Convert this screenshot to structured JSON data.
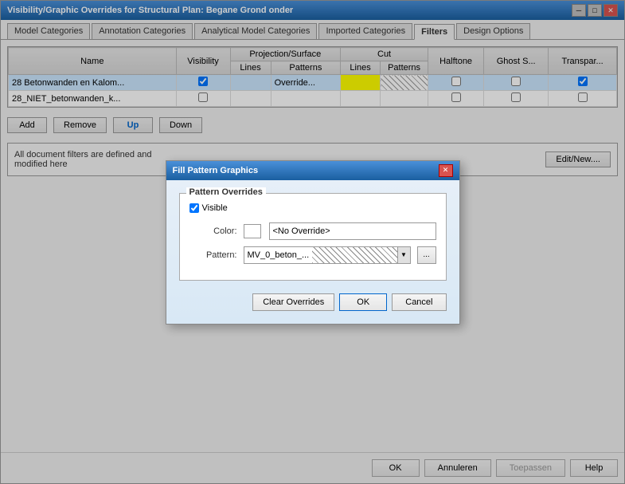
{
  "window": {
    "title": "Visibility/Graphic Overrides for Structural Plan: Begane Grond onder",
    "close_btn": "✕",
    "minimize_btn": "─",
    "maximize_btn": "□"
  },
  "tabs": [
    {
      "label": "Model Categories",
      "active": false
    },
    {
      "label": "Annotation Categories",
      "active": false
    },
    {
      "label": "Analytical Model Categories",
      "active": false
    },
    {
      "label": "Imported Categories",
      "active": false
    },
    {
      "label": "Filters",
      "active": true
    },
    {
      "label": "Design Options",
      "active": false
    }
  ],
  "table": {
    "headers": {
      "name": "Name",
      "visibility": "Visibility",
      "projection_surface": "Projection/Surface",
      "cut": "Cut",
      "halftone": "Halftone",
      "ghost_s": "Ghost S...",
      "transp": "Transpar...",
      "lines": "Lines",
      "patterns": "Patterns",
      "cut_lines": "Lines",
      "cut_patterns": "Patterns"
    },
    "rows": [
      {
        "name": "28 Betonwanden en Kalom...",
        "visibility_checked": true,
        "proj_lines": "",
        "proj_patterns": "Override...",
        "cut_lines_color": "yellow",
        "cut_patterns": "hatched",
        "halftone": false,
        "ghost": false,
        "transp": true
      },
      {
        "name": "28_NIET_betonwanden_k...",
        "visibility_checked": false,
        "proj_lines": "",
        "proj_patterns": "",
        "cut_lines_color": "",
        "cut_patterns": "",
        "halftone": false,
        "ghost": false,
        "transp": false
      }
    ]
  },
  "bottom_buttons": [
    {
      "label": "Add",
      "name": "add-button"
    },
    {
      "label": "Remove",
      "name": "remove-button"
    },
    {
      "label": "Up",
      "name": "up-button",
      "blue": true
    },
    {
      "label": "Down",
      "name": "down-button"
    }
  ],
  "info": {
    "text": "All document filters are defined and\nmodified here",
    "edit_new_btn": "Edit/New...."
  },
  "action_buttons": [
    {
      "label": "OK",
      "name": "ok-button"
    },
    {
      "label": "Annuleren",
      "name": "cancel-button"
    },
    {
      "label": "Toepassen",
      "name": "apply-button",
      "disabled": true
    },
    {
      "label": "Help",
      "name": "help-button"
    }
  ],
  "dialog": {
    "title": "Fill Pattern Graphics",
    "close_btn": "✕",
    "group_title": "Pattern Overrides",
    "visible_label": "Visible",
    "visible_checked": true,
    "color_label": "Color:",
    "color_value": "<No Override>",
    "pattern_label": "Pattern:",
    "pattern_value": "MV_0_beton_...",
    "browse_btn": "...",
    "clear_btn": "Clear Overrides",
    "ok_btn": "OK",
    "cancel_btn": "Cancel"
  }
}
